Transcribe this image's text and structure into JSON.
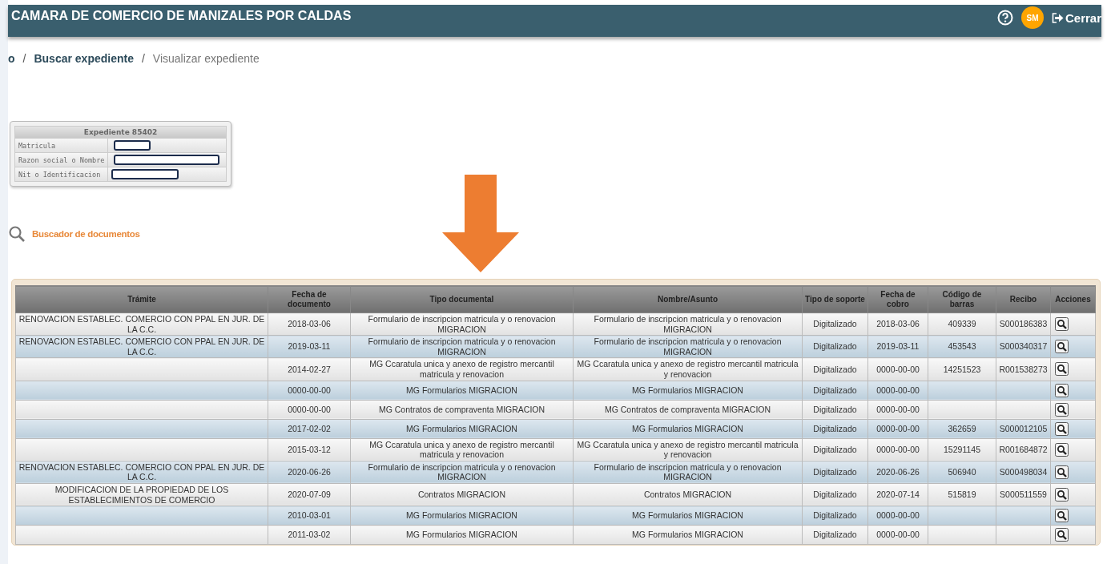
{
  "header": {
    "title": "CAMARA DE COMERCIO DE MANIZALES POR CALDAS",
    "avatar": "SM",
    "logout": "Cerrar"
  },
  "breadcrumb": [
    {
      "label": "o",
      "current": false
    },
    {
      "separator": "/",
      "label": "Buscar expediente",
      "current": false
    },
    {
      "separator": "/",
      "label": "Visualizar expediente",
      "current": true
    }
  ],
  "expediente": {
    "title": "Expediente 85402",
    "fields": [
      {
        "label": "Matricula"
      },
      {
        "label": "Razon social o Nombre"
      },
      {
        "label": "Nit o Identificacion"
      }
    ]
  },
  "search_link": "Buscador de documentos",
  "table": {
    "columns": [
      "Trámite",
      "Fecha de documento",
      "Tipo documental",
      "Nombre/Asunto",
      "Tipo de soporte",
      "Fecha de cobro",
      "Código de barras",
      "Recibo",
      "Acciones"
    ],
    "rows": [
      {
        "cells": [
          "RENOVACION ESTABLEC. COMERCIO CON PPAL EN JUR. DE LA C.C.",
          "2018-03-06",
          "Formulario de inscripcion matricula y o renovacion MIGRACION",
          "Formulario de inscripcion matricula y o renovacion MIGRACION",
          "Digitalizado",
          "2018-03-06",
          "409339",
          "S000186383"
        ]
      },
      {
        "cells": [
          "RENOVACION ESTABLEC. COMERCIO CON PPAL EN JUR. DE LA C.C.",
          "2019-03-11",
          "Formulario de inscripcion matricula y o renovacion MIGRACION",
          "Formulario de inscripcion matricula y o renovacion MIGRACION",
          "Digitalizado",
          "2019-03-11",
          "453543",
          "S000340317"
        ]
      },
      {
        "cells": [
          "",
          "2014-02-27",
          "MG Ccaratula unica y anexo de registro mercantil matricula y renovacion",
          "MG Ccaratula unica y anexo de registro mercantil matricula y renovacion",
          "Digitalizado",
          "0000-00-00",
          "14251523",
          "R001538273"
        ]
      },
      {
        "cells": [
          "",
          "0000-00-00",
          "MG Formularios MIGRACION",
          "MG Formularios MIGRACION",
          "Digitalizado",
          "0000-00-00",
          "",
          ""
        ]
      },
      {
        "cells": [
          "",
          "0000-00-00",
          "MG Contratos de compraventa MIGRACION",
          "MG Contratos de compraventa MIGRACION",
          "Digitalizado",
          "0000-00-00",
          "",
          ""
        ]
      },
      {
        "cells": [
          "",
          "2017-02-02",
          "MG Formularios MIGRACION",
          "MG Formularios MIGRACION",
          "Digitalizado",
          "0000-00-00",
          "362659",
          "S000012105"
        ]
      },
      {
        "cells": [
          "",
          "2015-03-12",
          "MG Ccaratula unica y anexo de registro mercantil matricula y renovacion",
          "MG Ccaratula unica y anexo de registro mercantil matricula y renovacion",
          "Digitalizado",
          "0000-00-00",
          "15291145",
          "R001684872"
        ]
      },
      {
        "cells": [
          "RENOVACION ESTABLEC. COMERCIO CON PPAL EN JUR. DE LA C.C.",
          "2020-06-26",
          "Formulario de inscripcion matricula y o renovacion MIGRACION",
          "Formulario de inscripcion matricula y o renovacion MIGRACION",
          "Digitalizado",
          "2020-06-26",
          "506940",
          "S000498034"
        ]
      },
      {
        "cells": [
          "MODIFICACION DE LA PROPIEDAD DE LOS ESTABLECIMIENTOS DE COMERCIO",
          "2020-07-09",
          "Contratos MIGRACION",
          "Contratos MIGRACION",
          "Digitalizado",
          "2020-07-14",
          "515819",
          "S000511559"
        ]
      },
      {
        "cells": [
          "",
          "2010-03-01",
          "MG Formularios MIGRACION",
          "MG Formularios MIGRACION",
          "Digitalizado",
          "0000-00-00",
          "",
          ""
        ]
      },
      {
        "cells": [
          "",
          "2011-03-02",
          "MG Formularios MIGRACION",
          "MG Formularios MIGRACION",
          "Digitalizado",
          "0000-00-00",
          "",
          ""
        ]
      }
    ]
  }
}
